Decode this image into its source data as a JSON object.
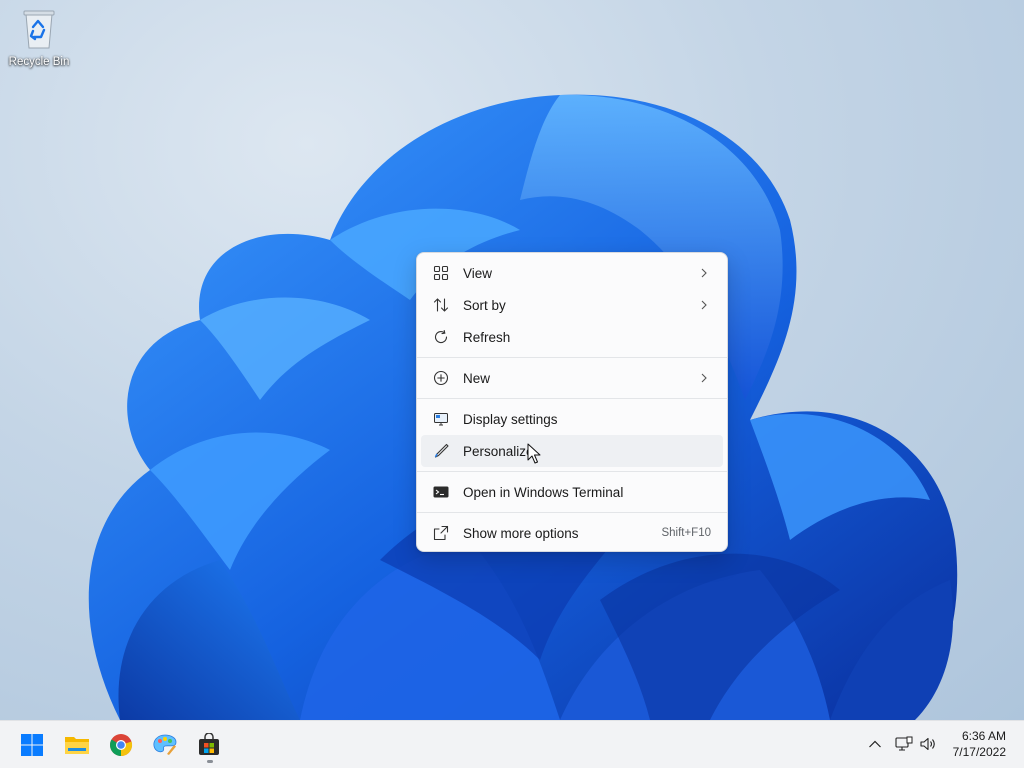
{
  "desktop": {
    "icons": [
      {
        "label": "Recycle Bin",
        "icon": "recycle-bin-icon"
      }
    ]
  },
  "context_menu": {
    "items": [
      {
        "label": "View",
        "icon": "grid-icon",
        "submenu": true
      },
      {
        "label": "Sort by",
        "icon": "sort-icon",
        "submenu": true
      },
      {
        "label": "Refresh",
        "icon": "refresh-icon",
        "submenu": false
      },
      {
        "label": "New",
        "icon": "plus-circle-icon",
        "submenu": true
      },
      {
        "label": "Display settings",
        "icon": "display-icon",
        "submenu": false
      },
      {
        "label": "Personalize",
        "icon": "brush-icon",
        "submenu": false,
        "hovered": true
      },
      {
        "label": "Open in Windows Terminal",
        "icon": "terminal-icon",
        "submenu": false
      },
      {
        "label": "Show more options",
        "icon": "share-icon",
        "submenu": false,
        "shortcut": "Shift+F10"
      }
    ]
  },
  "taskbar": {
    "apps": [
      {
        "name": "start",
        "icon": "windows-start-icon"
      },
      {
        "name": "file-explorer",
        "icon": "folder-icon"
      },
      {
        "name": "chrome",
        "icon": "chrome-icon"
      },
      {
        "name": "paint",
        "icon": "paint-icon"
      },
      {
        "name": "store",
        "icon": "store-icon",
        "active": true
      }
    ],
    "tray": {
      "icons": [
        "chevron-up-icon",
        "network-icon",
        "volume-icon"
      ],
      "time": "6:36 AM",
      "date": "7/17/2022"
    }
  },
  "colors": {
    "accent": "#0067c0",
    "bloom_blue": "#1a6fe8",
    "bloom_dark": "#0b3aa8"
  }
}
